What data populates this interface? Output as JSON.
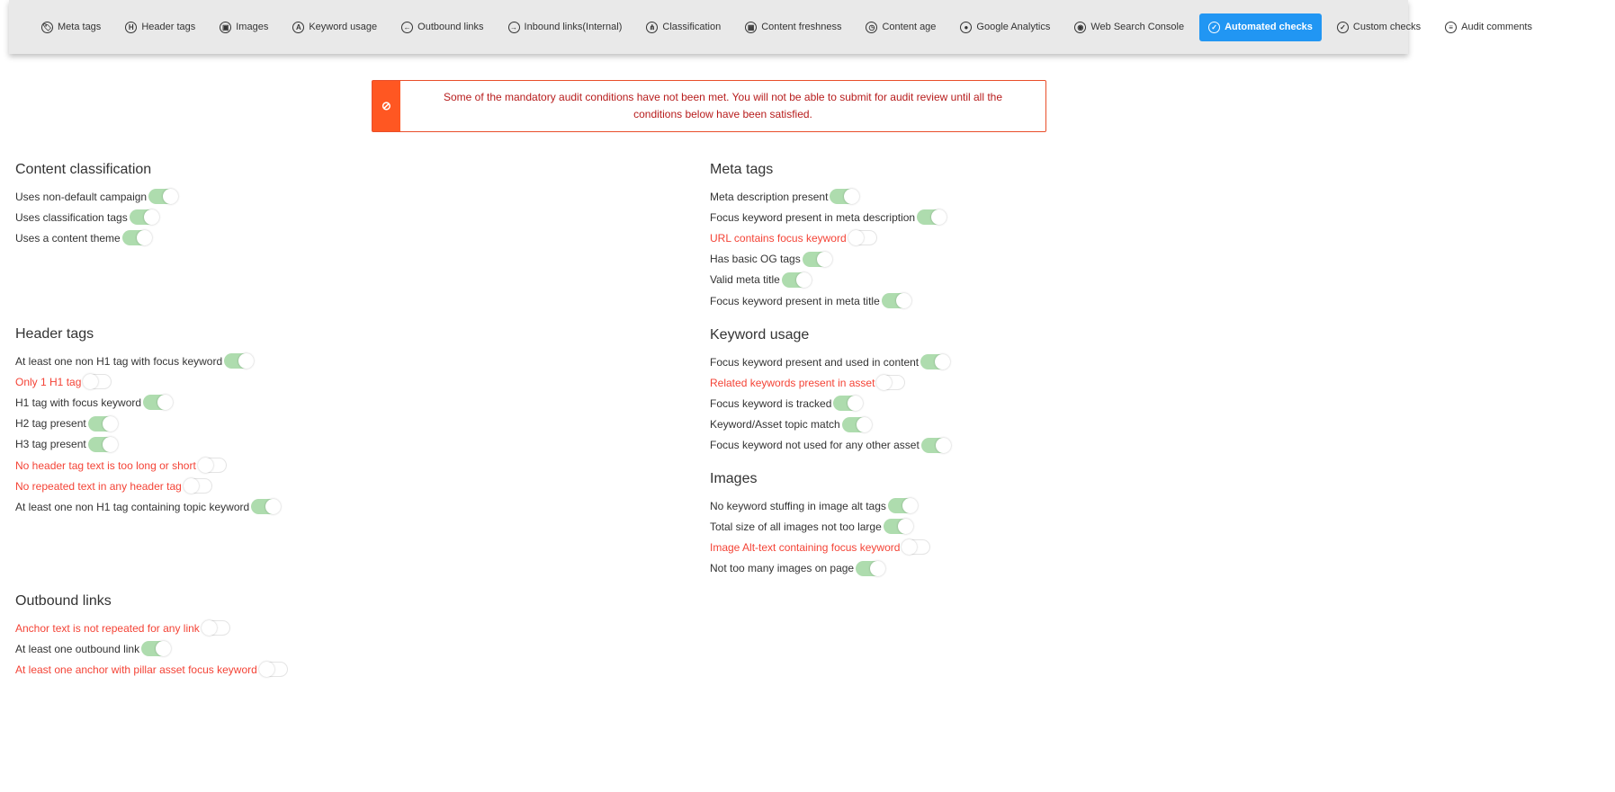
{
  "tabs": [
    {
      "label": "Meta tags",
      "icon": "tag-icon",
      "glyph": "🏷"
    },
    {
      "label": "Header tags",
      "icon": "header-icon",
      "glyph": "H"
    },
    {
      "label": "Images",
      "icon": "image-icon",
      "glyph": "▣"
    },
    {
      "label": "Keyword usage",
      "icon": "keyword-icon",
      "glyph": "A"
    },
    {
      "label": "Outbound links",
      "icon": "arrow-left-icon",
      "glyph": "←"
    },
    {
      "label": "Inbound links(Internal)",
      "icon": "arrow-right-icon",
      "glyph": "→"
    },
    {
      "label": "Classification",
      "icon": "sitemap-icon",
      "glyph": "⋔"
    },
    {
      "label": "Content freshness",
      "icon": "calendar-icon",
      "glyph": "▦"
    },
    {
      "label": "Content age",
      "icon": "clock-icon",
      "glyph": "◷"
    },
    {
      "label": "Google Analytics",
      "icon": "user-icon",
      "glyph": "●"
    },
    {
      "label": "Web Search Console",
      "icon": "globe-icon",
      "glyph": "◉"
    },
    {
      "label": "Automated checks",
      "icon": "check-circle-icon",
      "glyph": "✓",
      "active": true
    },
    {
      "label": "Custom checks",
      "icon": "check-circle-icon",
      "glyph": "✓"
    },
    {
      "label": "Audit comments",
      "icon": "comments-icon",
      "glyph": "≡"
    }
  ],
  "alert": {
    "icon": "ban-icon",
    "glyph": "⊘",
    "message": "Some of the mandatory audit conditions have not been met. You will not be able to submit for audit review until all the conditions below have been satisfied."
  },
  "colors": {
    "accent": "#2196f3",
    "alert": "#ff5722",
    "fail": "#f44336",
    "toggle_on": "#aedcae"
  },
  "sections": [
    {
      "title": "Content classification",
      "items": [
        {
          "label": "Uses non-default campaign",
          "on": true
        },
        {
          "label": "Uses classification tags",
          "on": true
        },
        {
          "label": "Uses a content theme",
          "on": true
        }
      ]
    },
    {
      "title": "Header tags",
      "items": [
        {
          "label": "At least one non H1 tag with focus keyword",
          "on": true
        },
        {
          "label": "Only 1 H1 tag",
          "on": false
        },
        {
          "label": "H1 tag with focus keyword",
          "on": true
        },
        {
          "label": "H2 tag present",
          "on": true
        },
        {
          "label": "H3 tag present",
          "on": true
        },
        {
          "label": "No header tag text is too long or short",
          "on": false
        },
        {
          "label": "No repeated text in any header tag",
          "on": false
        },
        {
          "label": "At least one non H1 tag containing topic keyword",
          "on": true
        }
      ]
    },
    {
      "title": "Outbound links",
      "items": [
        {
          "label": "Anchor text is not repeated for any link",
          "on": false
        },
        {
          "label": "At least one outbound link",
          "on": true
        },
        {
          "label": "At least one anchor with pillar asset focus keyword",
          "on": false
        }
      ]
    },
    {
      "title": "Meta tags",
      "items": [
        {
          "label": "Meta description present",
          "on": true
        },
        {
          "label": "Focus keyword present in meta description",
          "on": true
        },
        {
          "label": "URL contains focus keyword",
          "on": false
        },
        {
          "label": "Has basic OG tags",
          "on": true
        },
        {
          "label": "Valid meta title",
          "on": true
        },
        {
          "label": "Focus keyword present in meta title",
          "on": true
        }
      ]
    },
    {
      "title": "Keyword usage",
      "items": [
        {
          "label": "Focus keyword present and used in content",
          "on": true
        },
        {
          "label": "Related keywords present in asset",
          "on": false
        },
        {
          "label": "Focus keyword is tracked",
          "on": true
        },
        {
          "label": "Keyword/Asset topic match",
          "on": true
        },
        {
          "label": "Focus keyword not used for any other asset",
          "on": true
        }
      ]
    },
    {
      "title": "Images",
      "items": [
        {
          "label": "No keyword stuffing in image alt tags",
          "on": true
        },
        {
          "label": "Total size of all images not too large",
          "on": true
        },
        {
          "label": "Image Alt-text containing focus keyword",
          "on": false
        },
        {
          "label": "Not too many images on page",
          "on": true
        }
      ]
    }
  ]
}
